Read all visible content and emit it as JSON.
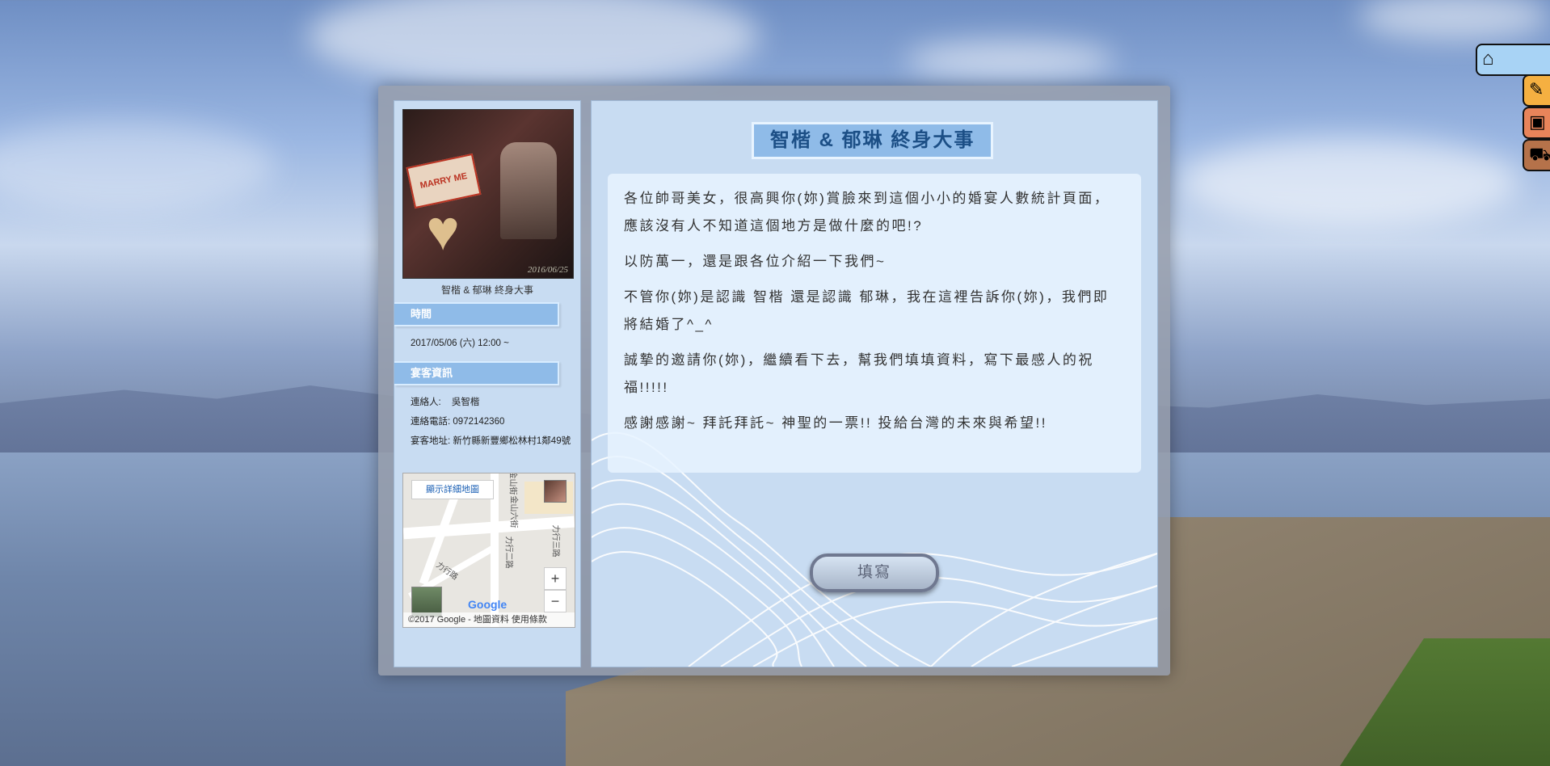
{
  "sidebar": {
    "photo_date": "2016/06/25",
    "photo_sign": "MARRY ME",
    "caption": "智楷 & 郁琳 終身大事",
    "time_heading": "時間",
    "time_value": "2017/05/06 (六) 12:00 ~",
    "guest_heading": "宴客資訊",
    "contact_label": "連絡人:",
    "contact_name": "吳智楷",
    "phone_label": "連絡電話:",
    "phone_value": "0972142360",
    "address_label": "宴客地址:",
    "address_value": "新竹縣新豐鄉松林村1鄰49號"
  },
  "map": {
    "detail_button": "顯示詳細地圖",
    "zoom_in": "+",
    "zoom_out": "−",
    "google": "Google",
    "footer": "©2017 Google - 地圖資料   使用條款",
    "labels": [
      "金山街",
      "金山六街",
      "力行二路",
      "力行路",
      "力行三路"
    ]
  },
  "main": {
    "title": "智楷 & 郁琳 終身大事",
    "paragraphs": [
      "各位帥哥美女，很高興你(妳)賞臉來到這個小小的婚宴人數統計頁面，應該沒有人不知道這個地方是做什麼的吧!?",
      "以防萬一，還是跟各位介紹一下我們~",
      "不管你(妳)是認識 智楷 還是認識 郁琳，我在這裡告訴你(妳)，我們即將結婚了^_^",
      "誠摯的邀請你(妳)，繼續看下去，幫我們填填資料，寫下最感人的祝福!!!!!",
      "感謝感謝~ 拜託拜託~ 神聖的一票!! 投給台灣的未來與希望!!"
    ],
    "fill_button": "填寫"
  },
  "nav": {
    "home_icon": "home-icon",
    "buttons": [
      {
        "icon": "pencil-icon",
        "color": "#f5b041"
      },
      {
        "icon": "image-icon",
        "color": "#e8845a"
      },
      {
        "icon": "car-icon",
        "color": "#b5724a"
      }
    ]
  }
}
